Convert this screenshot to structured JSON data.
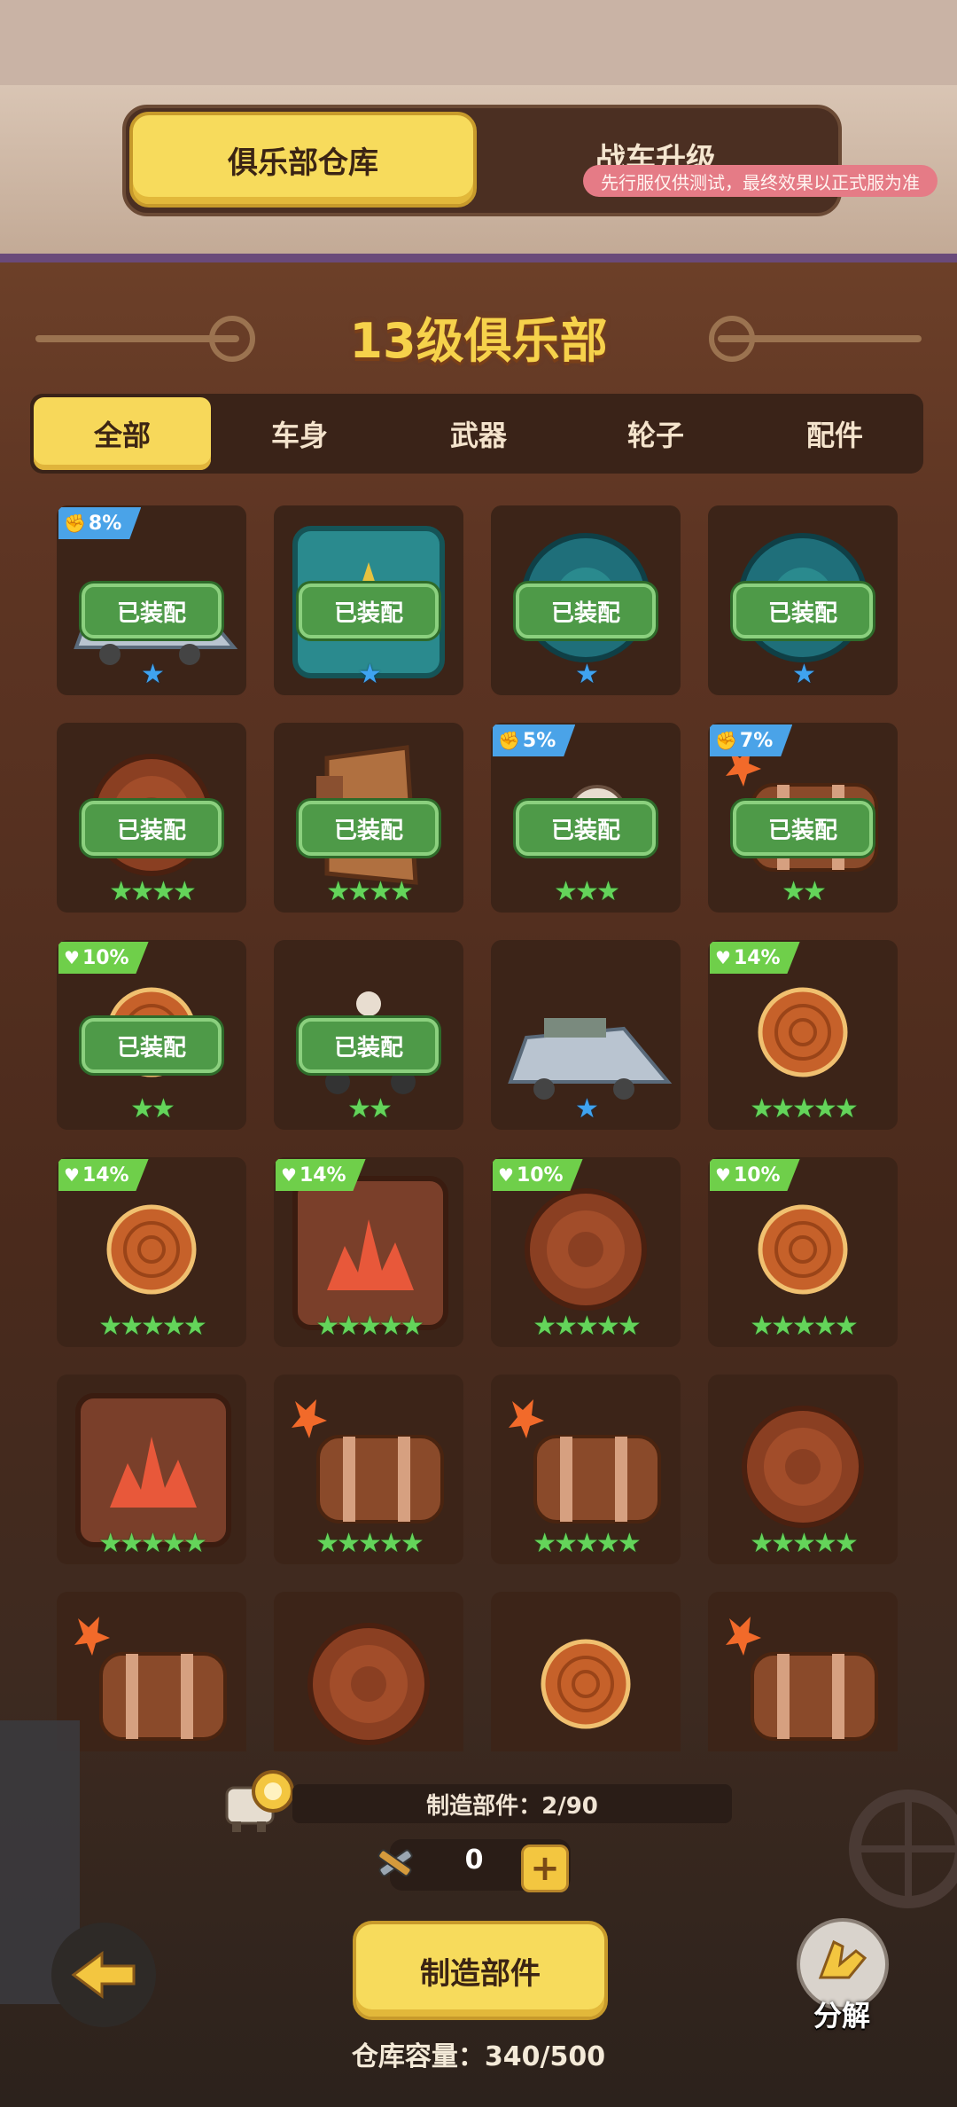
{
  "header": {
    "tabs": [
      {
        "label": "俱乐部仓库",
        "active": true
      },
      {
        "label": "战车升级",
        "active": false
      }
    ],
    "test_notice": "先行服仅供测试，最终效果以正式服为准"
  },
  "club_title": "13级俱乐部",
  "filters": [
    {
      "label": "全部",
      "active": true
    },
    {
      "label": "车身",
      "active": false
    },
    {
      "label": "武器",
      "active": false
    },
    {
      "label": "轮子",
      "active": false
    },
    {
      "label": "配件",
      "active": false
    }
  ],
  "equipped_label": "已装配",
  "items": [
    {
      "art": "car-body-icon",
      "badge": "8%",
      "badge_kind": "attack",
      "equipped": true,
      "stars": "★",
      "star_color": "blue"
    },
    {
      "art": "teal-shield-icon",
      "badge": "",
      "badge_kind": "",
      "equipped": true,
      "stars": "★",
      "star_color": "blue"
    },
    {
      "art": "teal-wheel-icon",
      "badge": "",
      "badge_kind": "",
      "equipped": true,
      "stars": "★",
      "star_color": "blue"
    },
    {
      "art": "teal-wheel-icon",
      "badge": "",
      "badge_kind": "",
      "equipped": true,
      "stars": "★",
      "star_color": "blue"
    },
    {
      "art": "wood-wheel-icon",
      "badge": "",
      "badge_kind": "",
      "equipped": true,
      "stars": "★★★★",
      "star_color": "green"
    },
    {
      "art": "wood-plank-icon",
      "badge": "",
      "badge_kind": "",
      "equipped": true,
      "stars": "★★★★",
      "star_color": "green"
    },
    {
      "art": "horn-icon",
      "badge": "5%",
      "badge_kind": "attack",
      "equipped": true,
      "stars": "★★★",
      "star_color": "green"
    },
    {
      "art": "barrel-icon",
      "badge": "7%",
      "badge_kind": "attack",
      "equipped": true,
      "stars": "★★",
      "star_color": "green"
    },
    {
      "art": "log-wheel-icon",
      "badge": "10%",
      "badge_kind": "health",
      "equipped": true,
      "stars": "★★",
      "star_color": "green"
    },
    {
      "art": "cart-icon",
      "badge": "",
      "badge_kind": "",
      "equipped": true,
      "stars": "★★",
      "star_color": "green"
    },
    {
      "art": "car-body-icon",
      "badge": "",
      "badge_kind": "",
      "equipped": false,
      "stars": "★",
      "star_color": "blue"
    },
    {
      "art": "log-wheel-icon",
      "badge": "14%",
      "badge_kind": "health",
      "equipped": false,
      "stars": "★★★★★",
      "star_color": "green"
    },
    {
      "art": "log-wheel-icon",
      "badge": "14%",
      "badge_kind": "health",
      "equipped": false,
      "stars": "★★★★★",
      "star_color": "green"
    },
    {
      "art": "spike-shield-icon",
      "badge": "14%",
      "badge_kind": "health",
      "equipped": false,
      "stars": "★★★★★",
      "star_color": "green"
    },
    {
      "art": "wood-wheel-icon",
      "badge": "10%",
      "badge_kind": "health",
      "equipped": false,
      "stars": "★★★★★",
      "star_color": "green"
    },
    {
      "art": "log-wheel-icon",
      "badge": "10%",
      "badge_kind": "health",
      "equipped": false,
      "stars": "★★★★★",
      "star_color": "green"
    },
    {
      "art": "spike-shield-icon",
      "badge": "",
      "badge_kind": "",
      "equipped": false,
      "stars": "★★★★★",
      "star_color": "green"
    },
    {
      "art": "barrel-icon",
      "badge": "",
      "badge_kind": "",
      "equipped": false,
      "stars": "★★★★★",
      "star_color": "green"
    },
    {
      "art": "barrel-icon",
      "badge": "",
      "badge_kind": "",
      "equipped": false,
      "stars": "★★★★★",
      "star_color": "green"
    },
    {
      "art": "wood-wheel-icon",
      "badge": "",
      "badge_kind": "",
      "equipped": false,
      "stars": "★★★★★",
      "star_color": "green"
    },
    {
      "art": "barrel-icon",
      "badge": "",
      "badge_kind": "",
      "equipped": false,
      "stars": "",
      "star_color": "green"
    },
    {
      "art": "wood-wheel-icon",
      "badge": "",
      "badge_kind": "",
      "equipped": false,
      "stars": "",
      "star_color": "green"
    },
    {
      "art": "log-wheel-icon",
      "badge": "",
      "badge_kind": "",
      "equipped": false,
      "stars": "",
      "star_color": "green"
    },
    {
      "art": "barrel-icon",
      "badge": "",
      "badge_kind": "",
      "equipped": false,
      "stars": "",
      "star_color": "green"
    }
  ],
  "crafting": {
    "progress_text": "制造部件：2/90",
    "material_count": "0",
    "plus_symbol": "+",
    "craft_button": "制造部件",
    "dismantle_label": "分解"
  },
  "capacity_text": "仓库容量：340/500",
  "colors": {
    "accent_yellow": "#f7db5c",
    "equipped_green": "#4e9a48",
    "star_green": "#64d45a",
    "star_blue": "#3fa3f0",
    "card_bg": "#3c2418"
  }
}
